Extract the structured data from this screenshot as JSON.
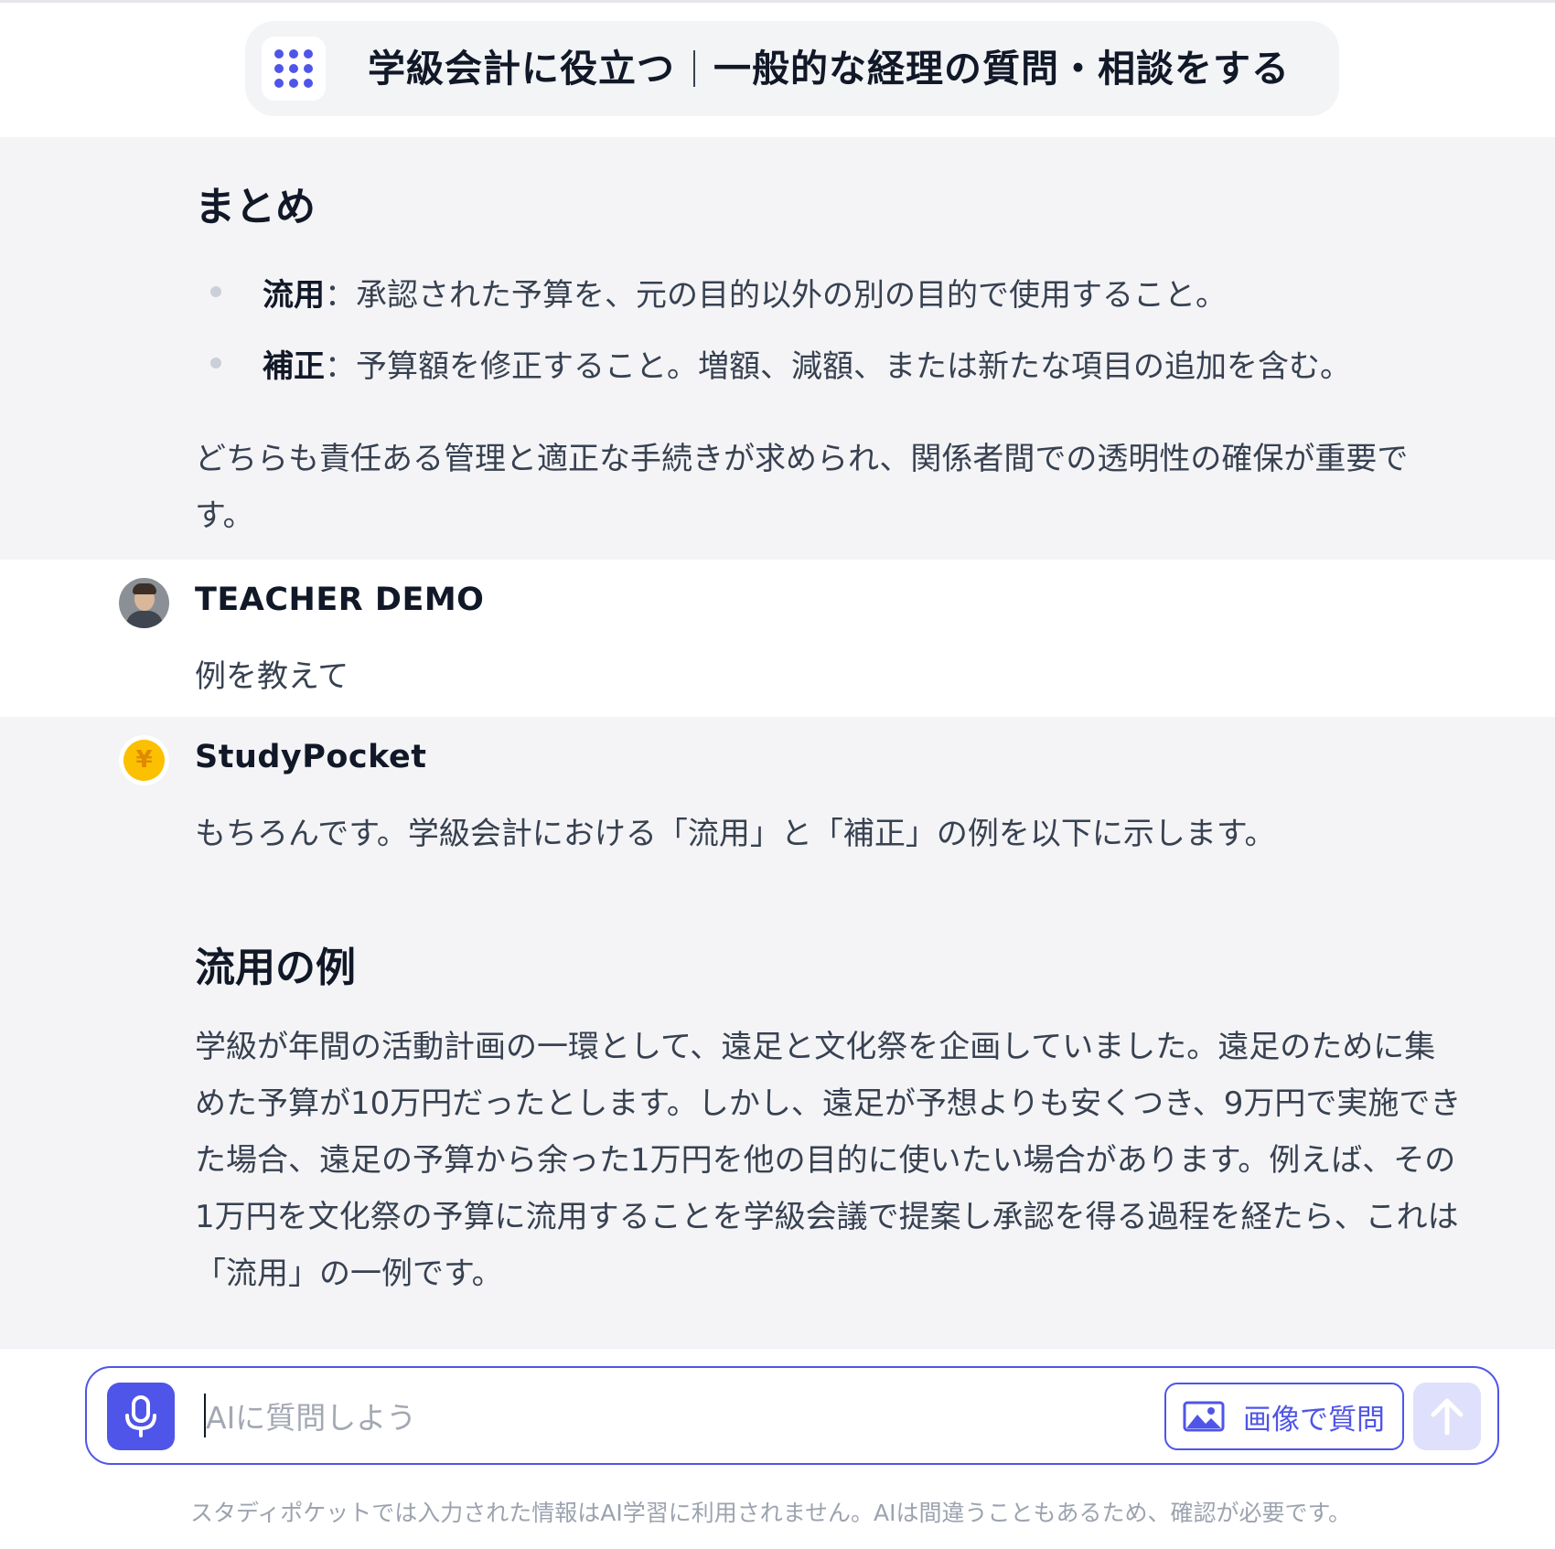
{
  "header": {
    "title_left": "学級会計に役立つ",
    "title_right": "一般的な経理の質問・相談をする"
  },
  "messages": {
    "summary": {
      "heading": "まとめ",
      "bullets": [
        {
          "term": "流用",
          "text": "：承認された予算を、元の目的以外の別の目的で使用すること。"
        },
        {
          "term": "補正",
          "text": "：予算額を修正すること。増額、減額、または新たな項目の追加を含む。"
        }
      ],
      "paragraph": "どちらも責任ある管理と適正な手続きが求められ、関係者間での透明性の確保が重要です。"
    },
    "user": {
      "name": "TEACHER DEMO",
      "text": "例を教えて"
    },
    "bot": {
      "name": "StudyPocket",
      "coin_symbol": "¥",
      "intro": "もちろんです。学級会計における「流用」と「補正」の例を以下に示します。",
      "section_heading": "流用の例",
      "paragraph": "学級が年間の活動計画の一環として、遠足と文化祭を企画していました。遠足のために集めた予算が10万円だったとします。しかし、遠足が予想よりも安くつき、9万円で実施できた場合、遠足の予算から余った1万円を他の目的に使いたい場合があります。例えば、その1万円を文化祭の予算に流用することを学級会議で提案し承認を得る過程を経たら、これは「流用」の一例です。"
    }
  },
  "composer": {
    "placeholder": "AIに質問しよう",
    "value": "",
    "image_button_label": "画像で質問",
    "disclaimer": "スタディポケットでは入力された情報はAI学習に利用されません。AIは間違うこともあるため、確認が必要です。"
  },
  "icons": {
    "app": "grid-dots-icon",
    "mic": "microphone-icon",
    "image": "image-icon",
    "send": "arrow-up-icon"
  },
  "colors": {
    "accent": "#4f55e8",
    "send_disabled": "#dfe0fb",
    "message_bg": "#f4f4f6",
    "coin": "#fbc000"
  }
}
